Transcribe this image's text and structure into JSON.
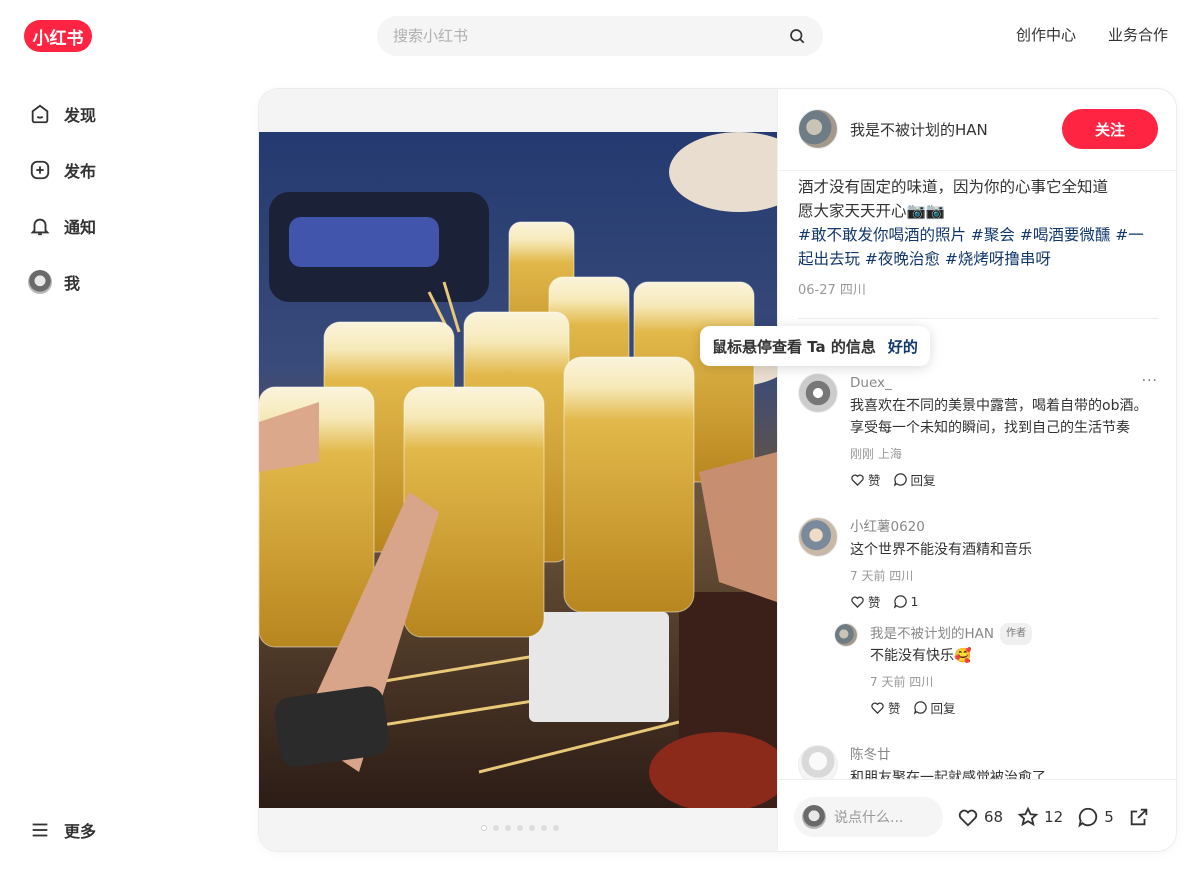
{
  "header": {
    "logo_text": "小红书",
    "search_placeholder": "搜索小红书",
    "links": [
      "创作中心",
      "业务合作"
    ]
  },
  "sidebar": {
    "items": [
      {
        "label": "发现",
        "icon": "home-icon"
      },
      {
        "label": "发布",
        "icon": "plus-square-icon"
      },
      {
        "label": "通知",
        "icon": "bell-icon"
      },
      {
        "label": "我",
        "icon": "avatar"
      }
    ],
    "more_label": "更多"
  },
  "note": {
    "image_count": 7,
    "active_image": 1,
    "author_name": "我是不被计划的HAN",
    "follow_label": "关注",
    "description_lines": [
      "酒才没有固定的味道，因为你的心事它全知道",
      "愿大家天天开心📷📷"
    ],
    "tags_text": "#敢不敢发你喝酒的照片 #聚会 #喝酒要微醺 #一起出去玩 #夜晚治愈 #烧烤呀撸串呀",
    "date_location": "06-27 四川"
  },
  "tooltip": {
    "text": "鼠标悬停查看 Ta 的信息",
    "ok": "好的"
  },
  "comments": [
    {
      "user": "Duex_",
      "text": "我喜欢在不同的美景中露营，喝着自带的ob酒。享受每一个未知的瞬间，找到自己的生活节奏",
      "meta": "刚刚 上海",
      "like_label": "赞",
      "reply_label": "回复"
    },
    {
      "user": "小红薯0620",
      "text": "这个世界不能没有酒精和音乐",
      "meta": "7 天前 四川",
      "like_label": "赞",
      "reply_count": "1"
    },
    {
      "user": "我是不被计划的HAN",
      "badge": "作者",
      "text": "不能没有快乐🥰",
      "meta": "7 天前 四川",
      "like_label": "赞",
      "reply_label": "回复"
    },
    {
      "user": "陈冬廿",
      "text": "和朋友聚在一起就感觉被治愈了"
    }
  ],
  "engagement": {
    "input_placeholder": "说点什么...",
    "likes": "68",
    "collects": "12",
    "comments": "5"
  },
  "colors": {
    "brand": "#ff2442",
    "tag": "#13386c"
  }
}
